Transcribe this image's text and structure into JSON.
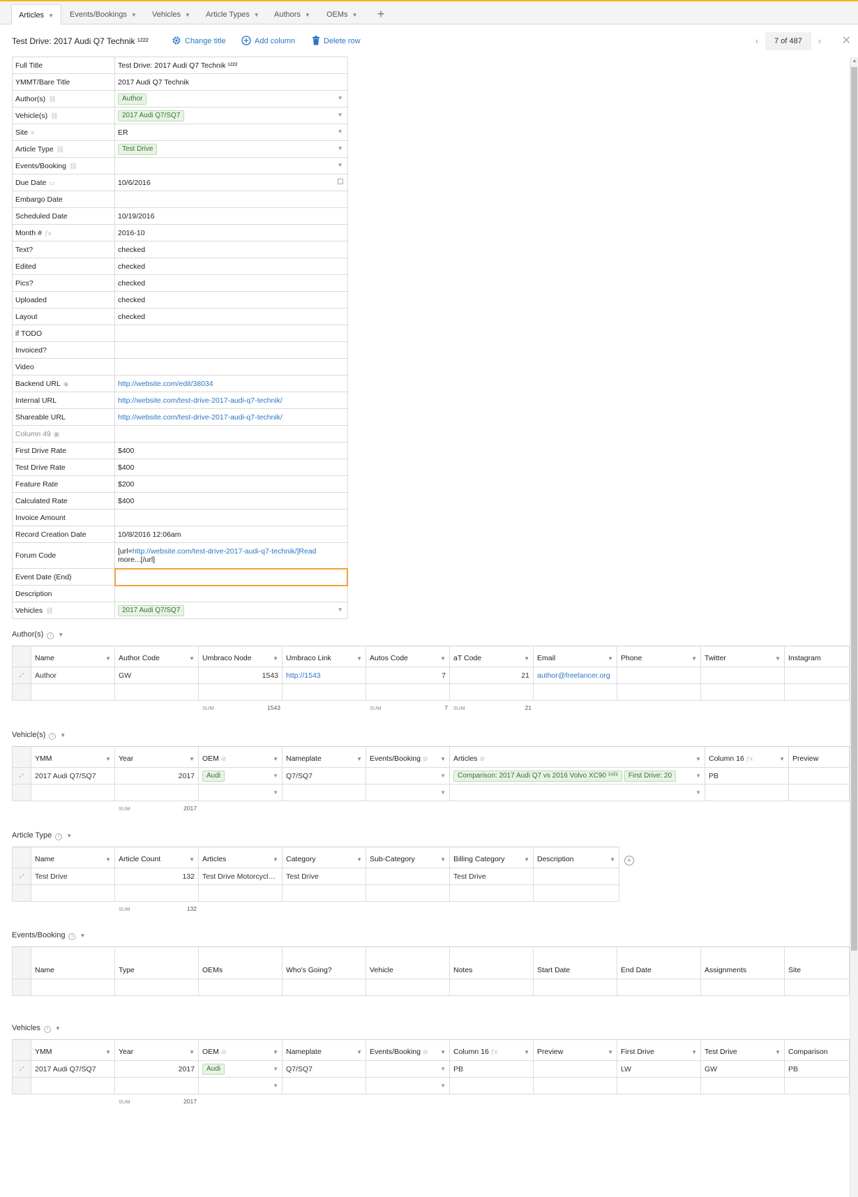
{
  "tabs": [
    {
      "label": "Articles",
      "active": true
    },
    {
      "label": "Events/Bookings"
    },
    {
      "label": "Vehicles"
    },
    {
      "label": "Article Types"
    },
    {
      "label": "Authors"
    },
    {
      "label": "OEMs"
    }
  ],
  "tab_add": "+",
  "record": {
    "title": "Test Drive: 2017 Audi Q7 Technik ¹²²²",
    "change_title": "Change title",
    "add_column": "Add column",
    "delete_row": "Delete row",
    "pager": "7 of 487",
    "prev": "‹",
    "next": "›",
    "close": "✕"
  },
  "fields": [
    {
      "label": "Full Title",
      "value": "Test Drive: 2017 Audi Q7 Technik ¹²²²"
    },
    {
      "label": "YMMT/Bare Title",
      "value": "2017 Audi Q7 Technik"
    },
    {
      "label": "Author(s)",
      "chip": "Author",
      "icon": "link-icon",
      "dropdown": true
    },
    {
      "label": "Vehicle(s)",
      "chip": "2017 Audi Q7/SQ7",
      "icon": "link-icon",
      "dropdown": true
    },
    {
      "label": "Site",
      "value": "ER",
      "icon": "list-icon",
      "dropdown": true
    },
    {
      "label": "Article Type",
      "chip": "Test Drive",
      "icon": "link-icon",
      "dropdown": true
    },
    {
      "label": "Events/Booking",
      "value": "",
      "icon": "link-icon",
      "dropdown": true
    },
    {
      "label": "Due Date",
      "value": "10/6/2016",
      "icon": "calendar-icon",
      "calendar": true
    },
    {
      "label": "Embargo Date",
      "value": ""
    },
    {
      "label": "Scheduled Date",
      "value": "10/19/2016"
    },
    {
      "label": "Month #",
      "value": "2016-10",
      "icon": "formula-icon"
    },
    {
      "label": "Text?",
      "value": "checked"
    },
    {
      "label": "Edited",
      "value": "checked"
    },
    {
      "label": "Pics?",
      "value": "checked"
    },
    {
      "label": "Uploaded",
      "value": "checked"
    },
    {
      "label": "Layout",
      "value": "checked"
    },
    {
      "label": "if TODO",
      "value": ""
    },
    {
      "label": "Invoiced?",
      "value": ""
    },
    {
      "label": "Video",
      "value": ""
    },
    {
      "label": "Backend URL",
      "value": "http://website.com/edit/38034",
      "link": true,
      "icon": "globe-icon"
    },
    {
      "label": "Internal URL",
      "value": "http://website.com/test-drive-2017-audi-q7-technik/",
      "link": true
    },
    {
      "label": "Shareable URL",
      "value": "http://website.com/test-drive-2017-audi-q7-technik/",
      "link": true
    },
    {
      "label": "Column 49",
      "value": "",
      "dim": true,
      "icon": "image-icon"
    },
    {
      "label": "First Drive Rate",
      "value": "$400"
    },
    {
      "label": "Test Drive Rate",
      "value": "$400"
    },
    {
      "label": "Feature Rate",
      "value": "$200"
    },
    {
      "label": "Calculated Rate",
      "value": "$400"
    },
    {
      "label": "Invoice Amount",
      "value": ""
    },
    {
      "label": "Record Creation Date",
      "value": "10/8/2016 12:06am"
    },
    {
      "label": "Forum Code",
      "value_prefix": "[url=",
      "value_link": "http://website.com/test-drive-2017-audi-q7-technik/]Read",
      "value_suffix": "more...[/url]",
      "tall": true
    },
    {
      "label": "Event Date (End)",
      "value": "",
      "selected": true
    },
    {
      "label": "Description",
      "value": ""
    },
    {
      "label": "Vehicles",
      "chip": "2017 Audi Q7/SQ7",
      "icon": "link-icon",
      "dropdown": true
    }
  ],
  "authors_section": {
    "title": "Author(s)",
    "columns": [
      "Name",
      "Author Code",
      "Umbraco Node",
      "Umbraco Link",
      "Autos Code",
      "aT Code",
      "Email",
      "Phone",
      "Twitter",
      "Instagram"
    ],
    "row": [
      "Author",
      "GW",
      "1543",
      "http://1543",
      "7",
      "21",
      "author@freelancer.org",
      "",
      "",
      ""
    ],
    "sum_label": "SUM",
    "sums": {
      "umbraco_node": "1543",
      "autos_code": "7",
      "at_code": "21"
    }
  },
  "vehicles_section": {
    "title": "Vehicle(s)",
    "columns": [
      "YMM",
      "Year",
      "OEM",
      "Nameplate",
      "Events/Booking",
      "Articles",
      "Column 16",
      "Preview"
    ],
    "row": {
      "ymm": "2017 Audi Q7/SQ7",
      "year": "2017",
      "oem": "Audi",
      "nameplate": "Q7/SQ7",
      "articles_1": "Comparison: 2017 Audi Q7 vs 2016 Volvo XC90 ¹⁹²¹",
      "articles_2": "First Drive: 20",
      "column16": "PB"
    },
    "sum_label": "SUM",
    "sum_year": "2017"
  },
  "article_type_section": {
    "title": "Article Type",
    "columns": [
      "Name",
      "Article Count",
      "Articles",
      "Category",
      "Sub-Category",
      "Billing Category",
      "Description"
    ],
    "row": [
      "Test Drive",
      "132",
      "Test Drive Motorcycl…",
      "Test Drive",
      "",
      "Test Drive",
      ""
    ],
    "sum_label": "SUM",
    "sum_count": "132",
    "add": "+"
  },
  "events_section": {
    "title": "Events/Booking",
    "columns": [
      "Name",
      "Type",
      "OEMs",
      "Who's Going?",
      "Vehicle",
      "Notes",
      "Start Date",
      "End Date",
      "Assignments",
      "Site"
    ]
  },
  "vehicles2_section": {
    "title": "Vehicles",
    "columns": [
      "YMM",
      "Year",
      "OEM",
      "Nameplate",
      "Events/Booking",
      "Column 16",
      "Preview",
      "First Drive",
      "Test Drive",
      "Comparison"
    ],
    "row": {
      "ymm": "2017 Audi Q7/SQ7",
      "year": "2017",
      "oem": "Audi",
      "nameplate": "Q7/SQ7",
      "column16": "PB",
      "first_drive": "LW",
      "test_drive": "GW",
      "comparison": "PB"
    },
    "sum_label": "SUM",
    "sum_year": "2017"
  },
  "colors": {
    "accent": "#2a76c5",
    "topline": "#f2b705",
    "chip_bg": "#e7f4e4",
    "selected_border": "#f0a23a"
  }
}
